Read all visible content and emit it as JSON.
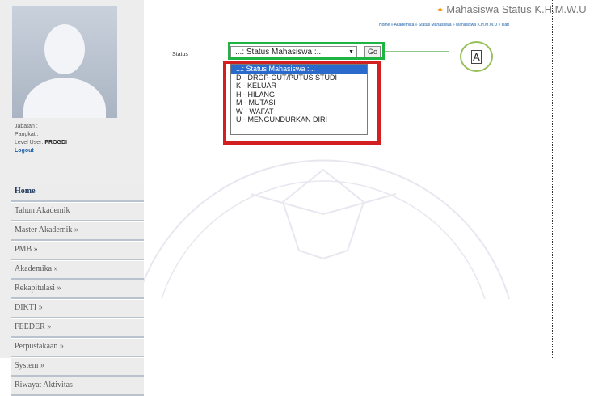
{
  "header": {
    "page_title": "Mahasiswa Status K.H.M.W.U",
    "breadcrumb": "Home » Akademika » Status Mahasiswa » Mahasiswa K.H.M.W.U » Daft"
  },
  "profile": {
    "jabatan_label": "Jabatan :",
    "pangkat_label": "Pangkat :",
    "level_label": "Level User:",
    "level_value": "PROGDI",
    "logout_label": "Logout"
  },
  "sidebar": {
    "items": [
      {
        "label": "Home"
      },
      {
        "label": "Tahun Akademik"
      },
      {
        "label": "Master Akademik »"
      },
      {
        "label": "PMB »"
      },
      {
        "label": "Akademika »"
      },
      {
        "label": "Rekapitulasi »"
      },
      {
        "label": "DIKTI »"
      },
      {
        "label": "FEEDER »"
      },
      {
        "label": "Perpustakaan »"
      },
      {
        "label": "System »"
      },
      {
        "label": "Riwayat Aktivitas"
      }
    ]
  },
  "form": {
    "status_label": "Status",
    "select_value": "...: Status Mahasiswa :..",
    "go_label": "Go",
    "options": [
      "...: Status Mahasiswa :...",
      "D - DROP-OUT/PUTUS STUDI",
      "K - KELUAR",
      "H - HILANG",
      "M - MUTASI",
      "W - WAFAT",
      "U - MENGUNDURKAN DIRI"
    ],
    "selected_index": 0
  },
  "annotation": {
    "callout_label": "A"
  },
  "colors": {
    "green_highlight": "#1fb341",
    "red_highlight": "#d21f1f",
    "selected_option": "#2a6acb",
    "link": "#1a5fa8"
  }
}
